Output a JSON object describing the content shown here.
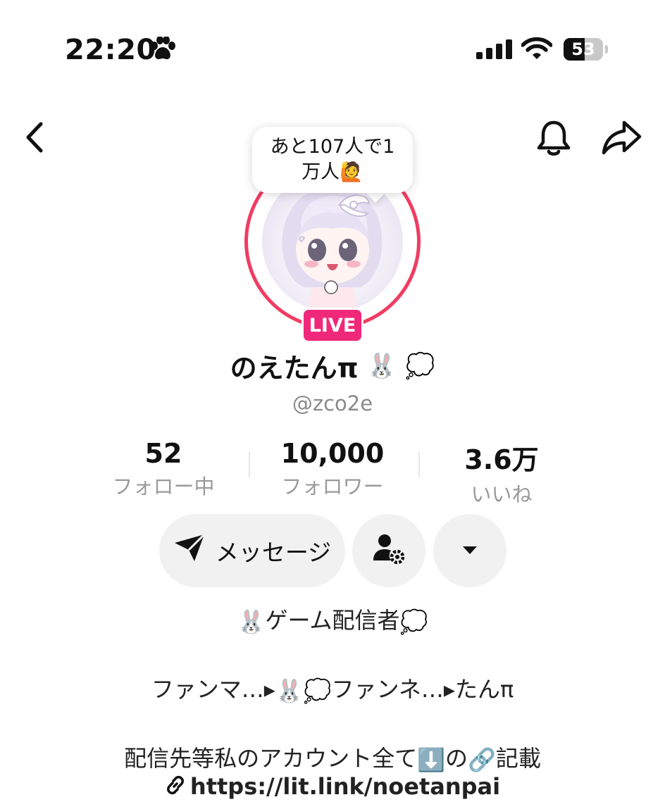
{
  "status_bar": {
    "time": "22:20",
    "battery": "53"
  },
  "tooltip": {
    "line1": "あと107人で1",
    "line2": "万人🙋"
  },
  "live_badge": "LIVE",
  "profile": {
    "name": "のえたんπ",
    "handle": "@zco2e"
  },
  "stats": [
    {
      "value": "52",
      "label": "フォロー中"
    },
    {
      "value": "10,000",
      "label": "フォロワー"
    },
    {
      "value": "3.6万",
      "label": "いいね"
    }
  ],
  "actions": {
    "message_label": "メッセージ"
  },
  "bio": {
    "line1": "ゲーム配信者",
    "line2a": "ファンマ…▸",
    "line2b": "ファンネ…▸たんπ",
    "line3a": "配信先等私のアカウント全て",
    "line3b": "の",
    "line3c": "記載",
    "link": "https://lit.link/noetanpai"
  },
  "icons": [
    "paw-icon",
    "signal-icon",
    "wifi-icon",
    "battery-icon",
    "back-icon",
    "bell-icon",
    "share-icon",
    "send-icon",
    "add-friend-settings-icon",
    "dropdown-icon",
    "rabbit-icon",
    "thought-bubble-icon",
    "down-arrow-icon",
    "link-icon"
  ],
  "colors": {
    "live": "#f0287a",
    "ring": "#f03c62",
    "button_bg": "#f1f1f1",
    "secondary_text": "#9a9a9a"
  }
}
